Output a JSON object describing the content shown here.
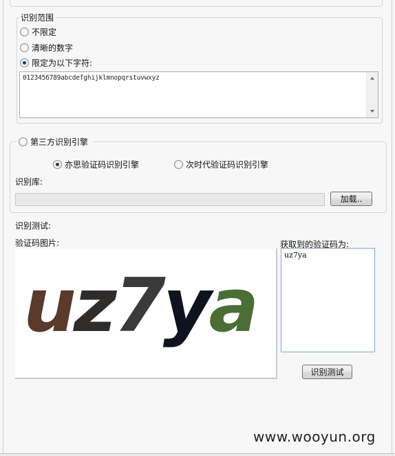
{
  "recognition_range": {
    "title": "识别范围",
    "options": [
      {
        "label": "不限定",
        "checked": false
      },
      {
        "label": "清晰的数字",
        "checked": false
      },
      {
        "label": "限定为以下字符:",
        "checked": true
      }
    ],
    "charset_value": "0123456789abcdefghijklmnopqrstuvwxyz"
  },
  "third_party_engine": {
    "title": "第三方识别引擎",
    "checked": false,
    "engines": [
      {
        "label": "亦思验证码识别引擎",
        "checked": true
      },
      {
        "label": "次时代验证码识别引擎",
        "checked": false
      }
    ],
    "library_label": "识别库:",
    "library_path": "",
    "load_button": "加载.."
  },
  "test": {
    "section_label": "识别测试:",
    "image_label": "验证码图片:",
    "captcha_chars": [
      {
        "ch": "u",
        "color": "#5a3a2a"
      },
      {
        "ch": "z",
        "color": "#2f2d2c"
      },
      {
        "ch": "7",
        "color": "#3a3a3a"
      },
      {
        "ch": "y",
        "color": "#0f1320"
      },
      {
        "ch": "a",
        "color": "#4a6e36"
      }
    ],
    "result_label": "获取到的验证码为:",
    "result_value": "uz7ya",
    "test_button": "识别测试"
  },
  "watermark": "www.wooyun.org"
}
